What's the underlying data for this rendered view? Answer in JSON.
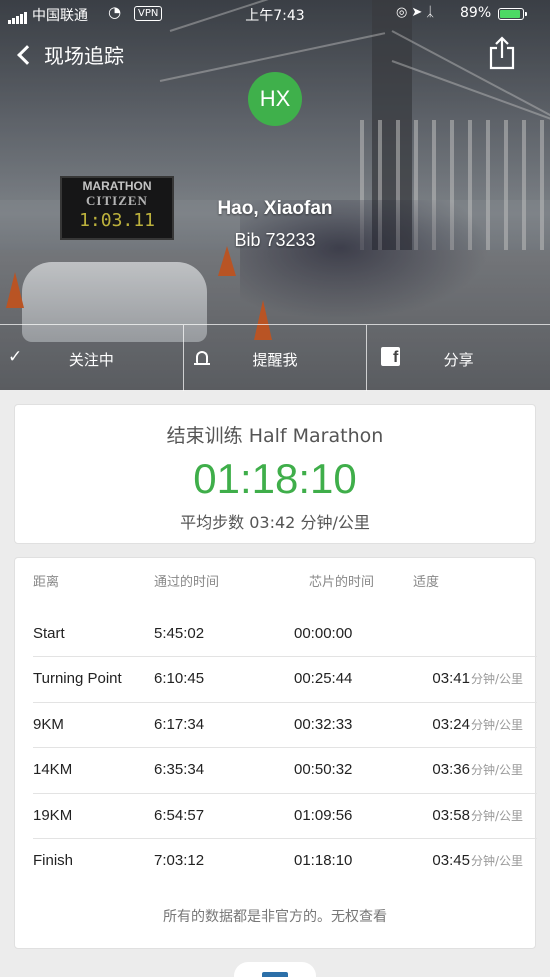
{
  "status_bar": {
    "carrier": "中国联通",
    "vpn": "VPN",
    "time": "上午7:43",
    "battery_pct": "89%",
    "battery_level": 0.89
  },
  "nav": {
    "back_label": "现场追踪"
  },
  "runner": {
    "initials": "HX",
    "name": "Hao, Xiaofan",
    "bib": "Bib 73233"
  },
  "hero_image": {
    "scoreboard_title": "MARATHON",
    "scoreboard_brand": "CITIZEN",
    "scoreboard_time": "1:03.11"
  },
  "actions": [
    {
      "icon": "check-icon",
      "label": "关注中"
    },
    {
      "icon": "bell-icon",
      "label": "提醒我"
    },
    {
      "icon": "facebook-icon",
      "label": "分享"
    }
  ],
  "summary": {
    "event": "结束训练 Half Marathon",
    "finish_time": "01:18:10",
    "pace": "平均步数 03:42 分钟/公里"
  },
  "splits": {
    "headers": [
      "距离",
      "通过的时间",
      "芯片的时间",
      "适度"
    ],
    "rows": [
      {
        "distance": "Start",
        "pass_time": "5:45:02",
        "chip_time": "00:00:00",
        "pace": "",
        "unit": ""
      },
      {
        "distance": "Turning Point",
        "pass_time": "6:10:45",
        "chip_time": "00:25:44",
        "pace": "03:41",
        "unit": "分钟/公里"
      },
      {
        "distance": "9KM",
        "pass_time": "6:17:34",
        "chip_time": "00:32:33",
        "pace": "03:24",
        "unit": "分钟/公里"
      },
      {
        "distance": "14KM",
        "pass_time": "6:35:34",
        "chip_time": "00:50:32",
        "pace": "03:36",
        "unit": "分钟/公里"
      },
      {
        "distance": "19KM",
        "pass_time": "6:54:57",
        "chip_time": "01:09:56",
        "pace": "03:58",
        "unit": "分钟/公里"
      },
      {
        "distance": "Finish",
        "pass_time": "7:03:12",
        "chip_time": "01:18:10",
        "pace": "03:45",
        "unit": "分钟/公里"
      }
    ],
    "footnote": "所有的数据都是非官方的。无权查看"
  },
  "colors": {
    "accent_green": "#3fae4a",
    "avatar_bg": "#3fb04b",
    "battery_green": "#4cd964"
  }
}
